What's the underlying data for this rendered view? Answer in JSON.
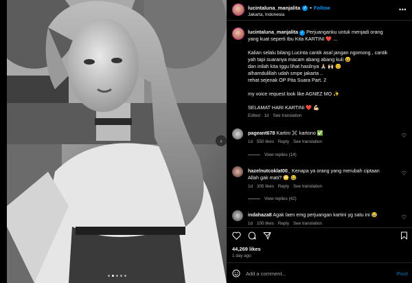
{
  "header": {
    "username": "lucintaluna_manjalita",
    "follow_label": "Follow",
    "separator": "•",
    "location": "Jakarta, Indonesia",
    "more_icon": "more-horizontal-icon"
  },
  "caption": {
    "username": "lucintaluna_manjalita",
    "lines": [
      "Perjuanganku untuk menjadi orang",
      "yang kuat seperti Ibu Kita KARTINI ❤️ ...",
      "",
      "Kalian selalu bilang Lucinta cantik asal jangan ngomong , cantik",
      "yah tapi suaranya macam abang abang kuli 😆",
      "dan inilah kita tggu lihat hasilnya 🙏🏼 🙌🏻 😊",
      "alhamdulillah udah smpe jakarta ..",
      "rehat sejenak OP Pita Suara Part. 2",
      "",
      "my voice request look like AGNEZ MO ✨",
      "",
      "SELAMAT HARI KARTINI ❤️ 💪🏻"
    ],
    "edited": "Edited · 1d",
    "see_translation": "See translation"
  },
  "comments": [
    {
      "username": "pageant678",
      "text": "Kartini ✖️ kartono ✅",
      "age": "1d",
      "likes": "550 likes",
      "reply": "Reply",
      "see_translation": "See translation",
      "view_replies": "View replies (14)"
    },
    {
      "username": "hazelnutcoklat00_",
      "text_line1": "Kenapa ya orang yang merubah ciptaan",
      "text_line2": "Allah gak mati? 🙄 😂",
      "age": "1d",
      "likes": "305 likes",
      "reply": "Reply",
      "see_translation": "See translation",
      "view_replies": "View replies (42)"
    },
    {
      "username": "indahaza8",
      "text": "Agak laen emg perjuangan kartini yg satu ini 😂",
      "age": "1d",
      "likes": "100 likes",
      "reply": "Reply",
      "see_translation": "See translation"
    }
  ],
  "actions": {
    "like_icon": "heart-icon",
    "comment_icon": "comment-icon",
    "share_icon": "send-icon",
    "save_icon": "bookmark-icon"
  },
  "likes_count": "44,269 likes",
  "post_age": "1 day ago",
  "add_comment": {
    "placeholder": "Add a comment...",
    "post_label": "Post",
    "emoji_icon": "smiley-icon"
  },
  "carousel": {
    "slides": 5,
    "active_index": 1
  },
  "colors": {
    "background": "#000000",
    "accent": "#0095f6",
    "muted": "#a8a8a8",
    "divider": "#262626"
  }
}
